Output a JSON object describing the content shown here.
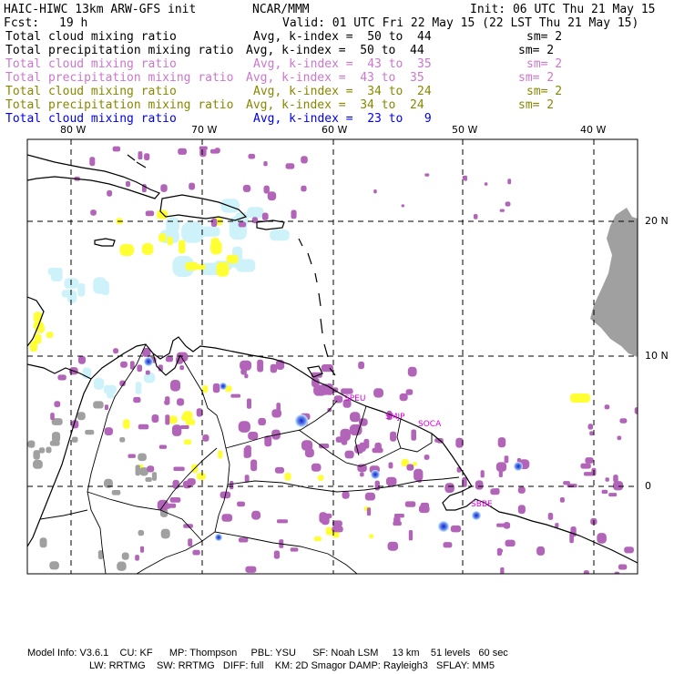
{
  "header": {
    "title": "HAIC-HIWC 13km ARW-GFS init",
    "org": "NCAR/MMM",
    "init": "Init: 06 UTC Thu 21 May 15",
    "fcst_label": "Fcst:",
    "fcst_value": "19 h",
    "valid": "Valid: 01 UTC Fri 22 May 15 (22 LST Thu 21 May 15)"
  },
  "legend": [
    {
      "name": "Total cloud mixing ratio",
      "range": "Avg, k-index =  50 to  44",
      "sm": "sm= 2",
      "color": "#000000"
    },
    {
      "name": "Total precipitation mixing ratio",
      "range": "Avg, k-index =  50 to  44",
      "sm": "sm= 2",
      "color": "#000000"
    },
    {
      "name": "Total cloud mixing ratio",
      "range": "Avg, k-index =  43 to  35",
      "sm": "sm= 2",
      "color": "#cc77cc"
    },
    {
      "name": "Total precipitation mixing ratio",
      "range": "Avg, k-index =  43 to  35",
      "sm": "sm= 2",
      "color": "#cc77cc"
    },
    {
      "name": "Total cloud mixing ratio",
      "range": "Avg, k-index =  34 to  24",
      "sm": "sm= 2",
      "color": "#888800"
    },
    {
      "name": "Total precipitation mixing ratio",
      "range": "Avg, k-index =  34 to  24",
      "sm": "sm= 2",
      "color": "#888800"
    },
    {
      "name": "Total cloud mixing ratio",
      "range": "Avg, k-index =  23 to   9",
      "sm": "",
      "color": "#0000ee"
    }
  ],
  "map": {
    "lon_labels": [
      "80 W",
      "70 W",
      "60 W",
      "50 W",
      "40 W"
    ],
    "lat_labels": [
      "20 N",
      "10 N",
      "0"
    ],
    "sites": [
      "SPEU",
      "SMJP",
      "SOCA",
      "SBBE"
    ],
    "colors": {
      "purple": "#b264b8",
      "gray": "#a0a0a0",
      "yellow": "#ffff33",
      "lightblue": "#cdf2fa",
      "blue": "#2244dd"
    }
  },
  "footer": {
    "line1": "Model Info: V3.6.1    CU: KF      MP: Thompson     PBL: YSU      SF: Noah LSM     13 km    51 levels   60 sec",
    "line2": "LW: RRTMG    SW: RRTMG   DIFF: full    KM: 2D Smagor DAMP: Rayleigh3   SFLAY: MM5"
  }
}
